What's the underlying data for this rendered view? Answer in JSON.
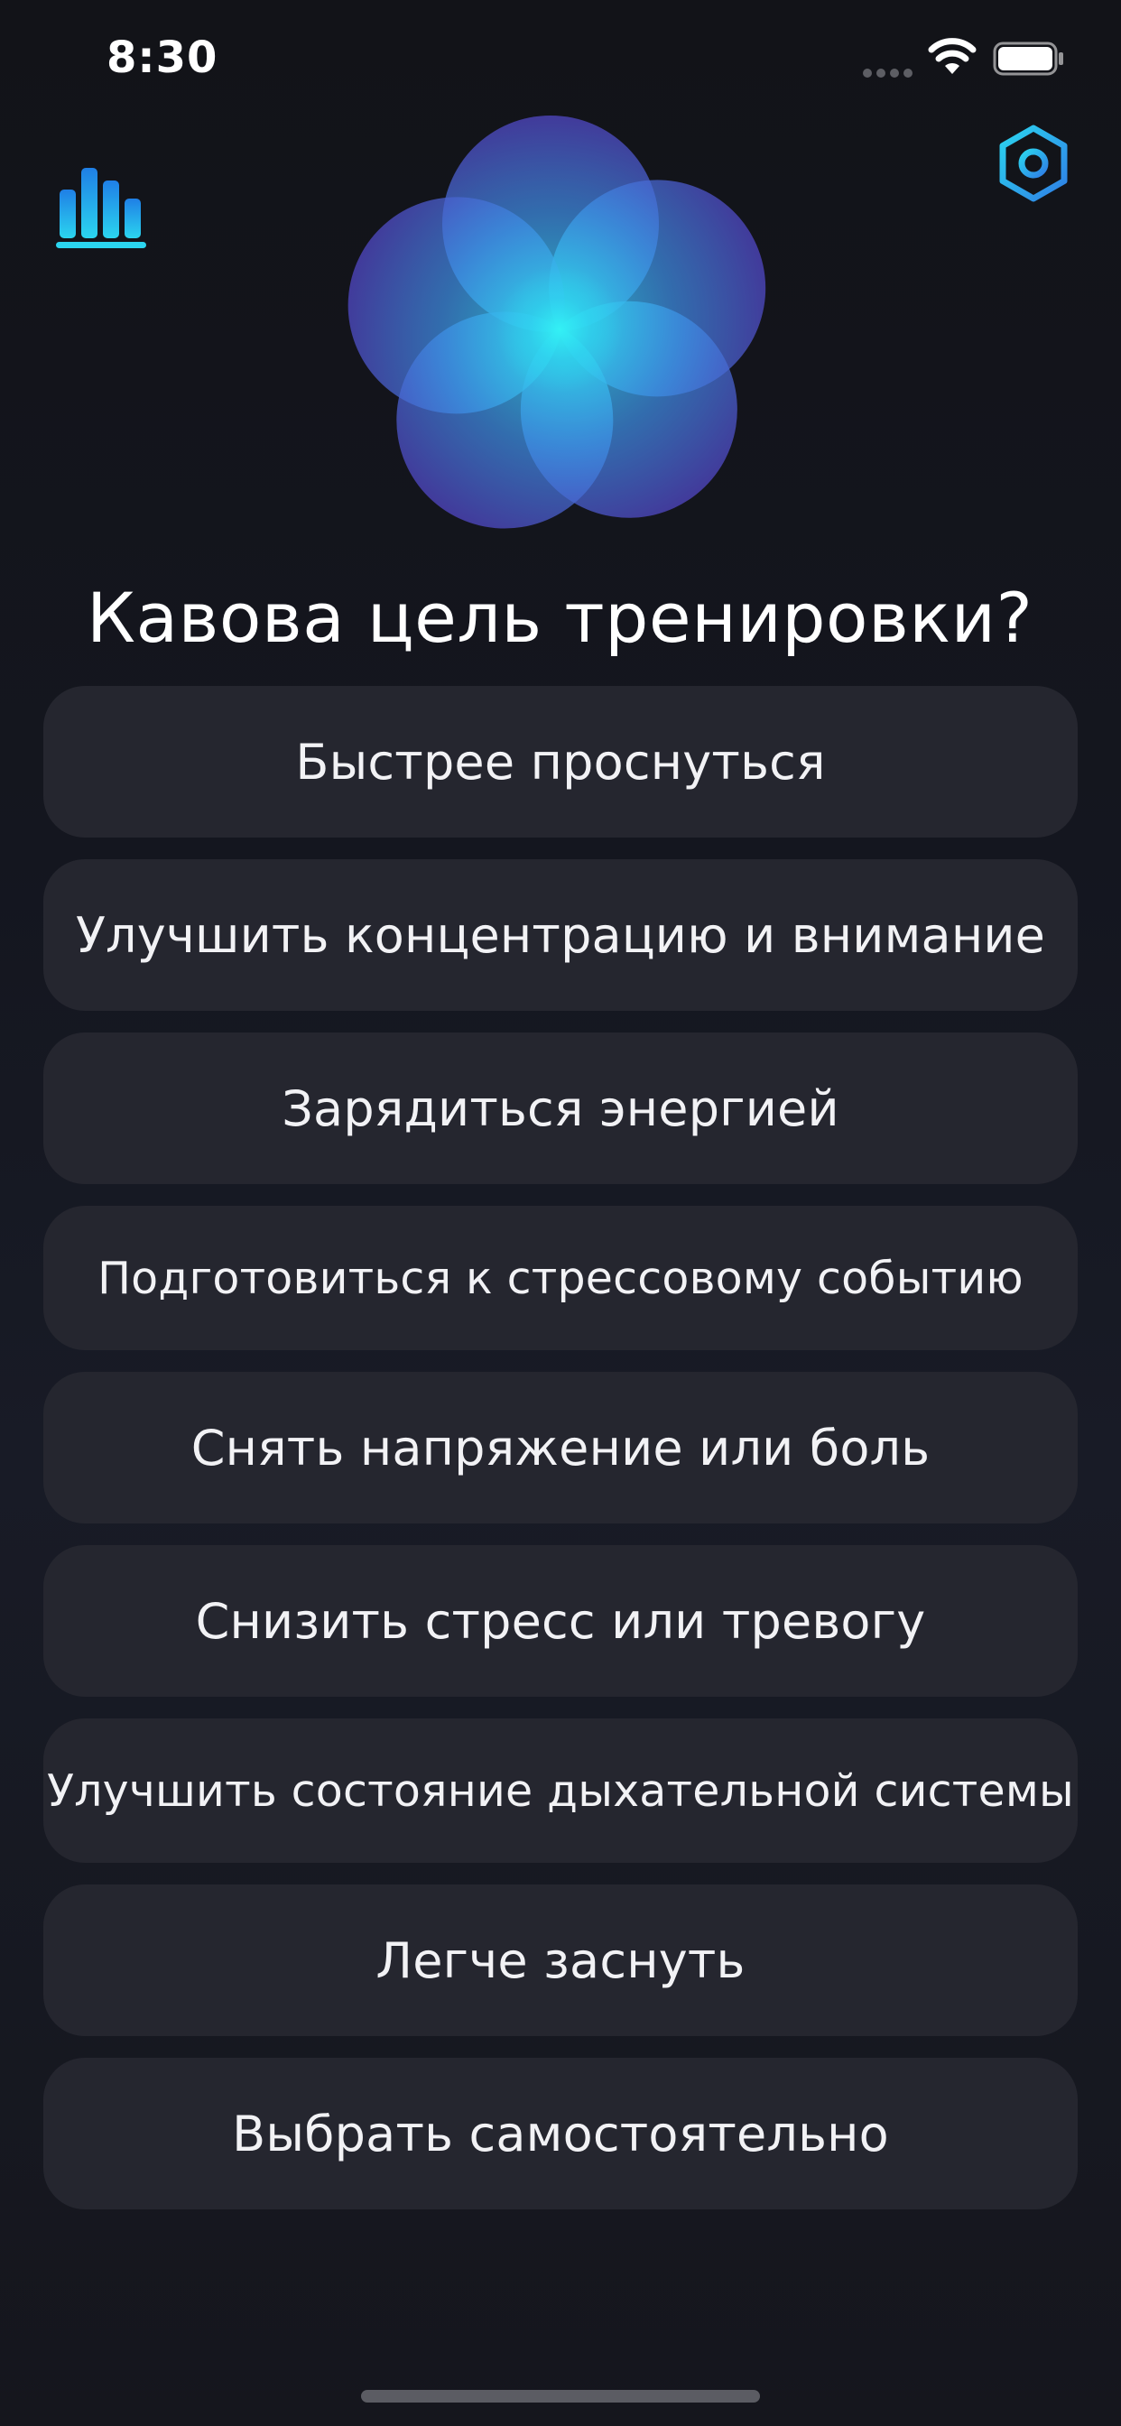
{
  "status_bar": {
    "time": "8:30"
  },
  "header": {
    "stats_icon": "bar-chart-icon",
    "settings_icon": "hexagon-settings-icon",
    "logo_icon": "breathing-flower-logo"
  },
  "question": "Кавова цель тренировки?",
  "options": [
    {
      "label": "Быстрее проснуться"
    },
    {
      "label": "Улучшить концентрацию и внимание"
    },
    {
      "label": "Зарядиться энергией"
    },
    {
      "label": "Подготовиться к стрессовому событию"
    },
    {
      "label": "Снять напряжение или боль"
    },
    {
      "label": "Снизить стресс или тревогу"
    },
    {
      "label": "Улучшить состояние дыхательной системы"
    },
    {
      "label": "Легче заснуть"
    },
    {
      "label": "Выбрать самостоятельно"
    }
  ],
  "colors": {
    "background": "#14161f",
    "button": "#25262f",
    "accent_cyan": "#22e3f0",
    "accent_blue": "#2f8cf0",
    "accent_purple": "#5a4fc8"
  }
}
